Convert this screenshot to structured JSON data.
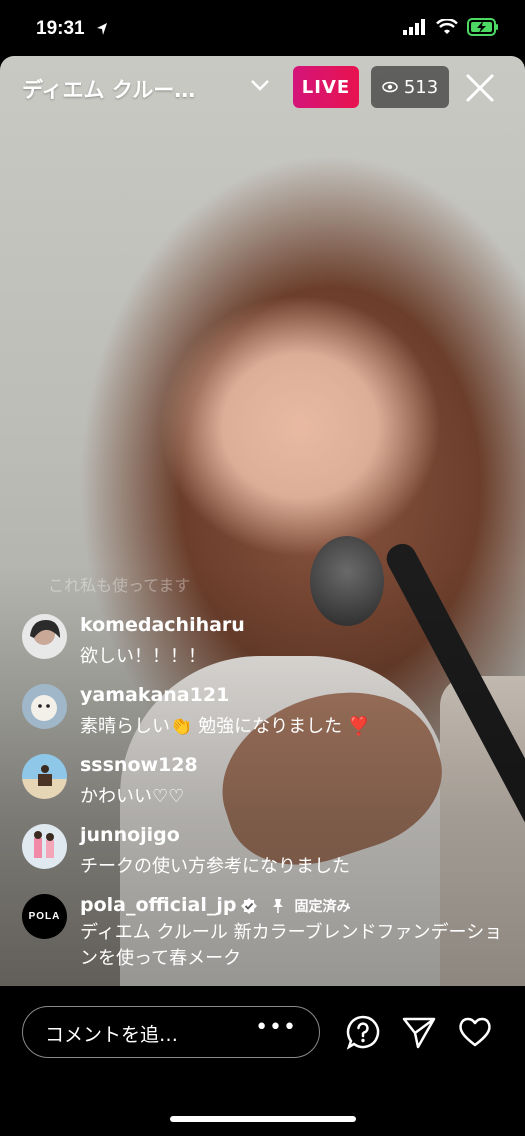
{
  "status_bar": {
    "time": "19:31"
  },
  "header": {
    "title": "ディエム クルー…",
    "live_label": "LIVE",
    "viewer_count": "513"
  },
  "faded_comment": "これ私も使ってます",
  "comments": [
    {
      "username": "komedachiharu",
      "text": "欲しい！！！！"
    },
    {
      "username": "yamakana121",
      "text": "素晴らしい👏 勉強になりました ❣️"
    },
    {
      "username": "sssnow128",
      "text": "かわいい♡♡"
    },
    {
      "username": "junnojigo",
      "text": "チークの使い方参考になりました"
    }
  ],
  "pinned_comment": {
    "avatar_text": "POLA",
    "username": "pola_official_jp",
    "pin_label": "固定済み",
    "text": "ディエム クルール 新カラーブレンドファンデーションを使って春メーク"
  },
  "footer": {
    "comment_placeholder": "コメントを追…",
    "more_label": "•••"
  },
  "icons": {
    "live_color": "#e0136a"
  }
}
